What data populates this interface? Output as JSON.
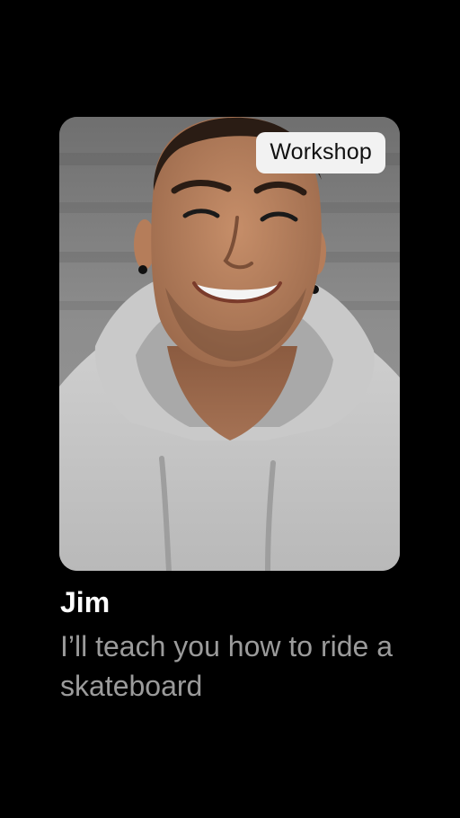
{
  "card": {
    "badge_label": "Workshop",
    "photo": {
      "subject": "smiling man in grey hoodie",
      "colors": {
        "background": "#8a8a8a",
        "hoodie": "#c4c4c4",
        "skin": "#b7825f",
        "hair": "#2a1c14"
      }
    },
    "name": "Jim",
    "description": "I’ll teach you how to ride a skateboard"
  },
  "colors": {
    "page_background": "#000000",
    "name_text": "#ffffff",
    "description_text": "#9b9b9b",
    "badge_background": "#f2f2f2",
    "badge_text": "#111111"
  }
}
